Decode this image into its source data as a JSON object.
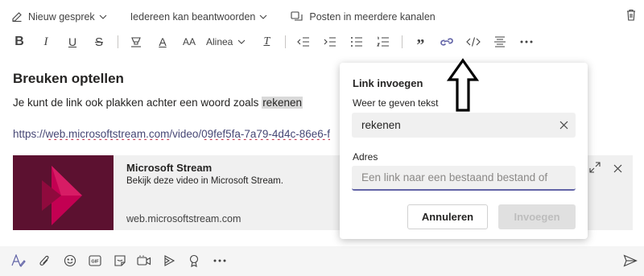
{
  "compose": {
    "options": {
      "new_conversation": "Nieuw gesprek",
      "reply_permission": "Iedereen kan beantwoorden",
      "post_multiple": "Posten in meerdere kanalen"
    },
    "format_bar": {
      "bold": "B",
      "italic": "I",
      "underline": "U",
      "strikethrough": "S",
      "font_color": "A",
      "font_size": "AA",
      "paragraph": "Alinea",
      "clear_format": "T",
      "quote": "”"
    },
    "document": {
      "title": "Breuken optellen",
      "line_prefix": "Je kunt de link ook plakken achter een woord zoals ",
      "line_highlight": "rekenen",
      "url_prefix": "https://",
      "url_underlined": "web.microsoftstream.com",
      "url_mid": "/video/",
      "url_rest": "09fef5fa-7a79-4d4c-86e6-f"
    },
    "preview_card": {
      "title": "Microsoft Stream",
      "description": "Bekijk deze video in Microsoft Stream.",
      "host": "web.microsoftstream.com"
    }
  },
  "link_dialog": {
    "title": "Link invoegen",
    "display_text_label": "Weer te geven tekst",
    "display_text_value": "rekenen",
    "address_label": "Adres",
    "address_placeholder": "Een link naar een bestaand bestand of",
    "cancel_label": "Annuleren",
    "insert_label": "Invoegen"
  },
  "colors": {
    "accent": "#6264a7",
    "stream_brand": "#c30052",
    "stream_bg": "#5c1130"
  },
  "icons": [
    "edit-icon",
    "chevron-down-icon",
    "channels-icon",
    "trash-icon",
    "link-icon",
    "code-icon",
    "align-icon",
    "more-icon",
    "expand-icon",
    "close-icon",
    "format-icon",
    "attach-icon",
    "emoji-icon",
    "gif-icon",
    "sticker-icon",
    "meet-icon",
    "stream-icon",
    "praise-icon",
    "send-icon",
    "arrow-up-icon"
  ]
}
